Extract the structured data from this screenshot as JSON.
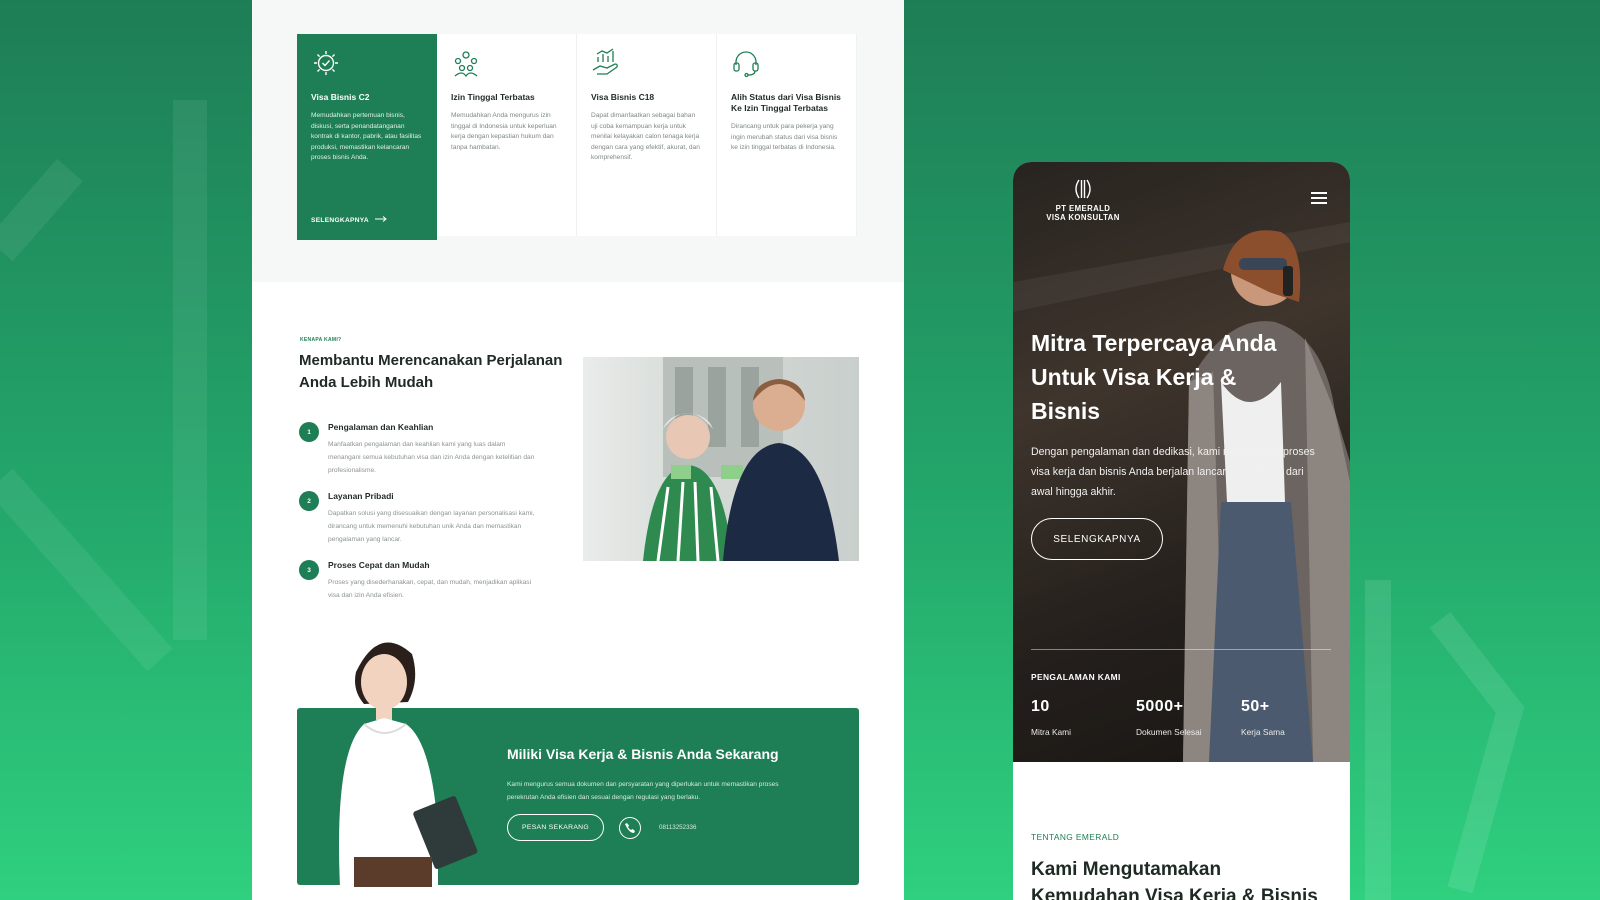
{
  "colors": {
    "brand_green": "#1e7e55",
    "background_gradient": [
      "#1e7d56",
      "#2fd07f"
    ]
  },
  "desktop": {
    "services": [
      {
        "icon": "gear-check-icon",
        "title": "Visa Bisnis C2",
        "desc": "Memudahkan pertemuan bisnis, diskusi, serta penandatanganan kontrak di kantor, pabrik, atau fasilitas produksi, memastikan kelancaran proses bisnis Anda.",
        "more": "SELENGKAPNYA"
      },
      {
        "icon": "team-icon",
        "title": "Izin Tinggal Terbatas",
        "desc": "Memudahkan Anda mengurus izin tinggal di Indonesia untuk keperluan kerja dengan kepastian hukum dan tanpa hambatan."
      },
      {
        "icon": "growth-hand-icon",
        "title": "Visa Bisnis C18",
        "desc": "Dapat dimanfaatkan sebagai bahan uji coba kemampuan kerja untuk menilai kelayakan calon tenaga kerja dengan cara yang efektif, akurat, dan komprehensif."
      },
      {
        "icon": "headset-icon",
        "title": "Alih Status dari Visa Bisnis Ke Izin Tinggal Terbatas",
        "desc": "Dirancang untuk para pekerja yang ingin merubah status dari visa bisnis ke izin tinggal terbatas di Indonesia."
      }
    ],
    "why": {
      "eyebrow": "KENAPA KAMI?",
      "title": "Membantu Merencanakan Perjalanan Anda Lebih Mudah",
      "items": [
        {
          "num": "1",
          "title": "Pengalaman dan Keahlian",
          "desc": "Manfaatkan pengalaman dan keahlian kami yang luas dalam menangani semua kebutuhan visa dan izin Anda dengan ketelitian dan profesionalisme."
        },
        {
          "num": "2",
          "title": "Layanan Pribadi",
          "desc": "Dapatkan solusi yang disesuaikan dengan layanan personalisasi kami, dirancang untuk memenuhi kebutuhan unik Anda dan memastikan pengalaman yang lancar."
        },
        {
          "num": "3",
          "title": "Proses Cepat dan Mudah",
          "desc": "Proses yang disederhanakan, cepat, dan mudah, menjadikan aplikasi visa dan izin Anda efisien."
        }
      ]
    },
    "cta": {
      "title": "Miliki Visa Kerja & Bisnis Anda Sekarang",
      "desc": "Kami mengurus semua dokumen dan persyaratan yang diperlukan untuk memastikan proses perekrutan Anda efisien dan sesuai dengan regulasi yang berlaku.",
      "button": "PESAN SEKARANG",
      "phone": "08113252336"
    }
  },
  "mobile": {
    "logo_line1": "PT EMERALD",
    "logo_line2": "VISA KONSULTAN",
    "hero_title": "Mitra Terpercaya Anda Untuk Visa Kerja & Bisnis",
    "hero_desc": "Dengan pengalaman dan dedikasi, kami memastikan proses visa kerja dan bisnis Anda berjalan lancar dan efisien, dari awal hingga akhir.",
    "hero_button": "SELENGKAPNYA",
    "stats_label": "PENGALAMAN KAMI",
    "stats": [
      {
        "value": "10",
        "label": "Mitra Kami"
      },
      {
        "value": "5000+",
        "label": "Dokumen Selesai"
      },
      {
        "value": "50+",
        "label": "Kerja Sama"
      }
    ],
    "about_eyebrow": "TENTANG EMERALD",
    "about_title": "Kami Mengutamakan Kemudahan Visa Kerja & Bisnis"
  }
}
